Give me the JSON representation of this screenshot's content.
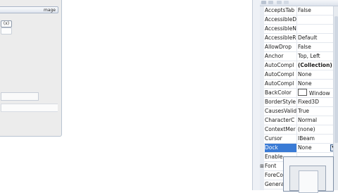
{
  "designer": {
    "caption_text": "mage",
    "tool_button_text": "(x)"
  },
  "properties": [
    {
      "name": "AcceptsTab",
      "value": "False"
    },
    {
      "name": "AccessibleD",
      "value": ""
    },
    {
      "name": "AccessibleN",
      "value": ""
    },
    {
      "name": "AccessibleR",
      "value": "Default"
    },
    {
      "name": "AllowDrop",
      "value": "False"
    },
    {
      "name": "Anchor",
      "value": "Top, Left"
    },
    {
      "name": "AutoCompl",
      "value": "(Collection)"
    },
    {
      "name": "AutoCompl",
      "value": "None"
    },
    {
      "name": "AutoCompl",
      "value": "None"
    },
    {
      "name": "BackColor",
      "value": "Window"
    },
    {
      "name": "BorderStyle",
      "value": "Fixed3D"
    },
    {
      "name": "CausesValid",
      "value": "True"
    },
    {
      "name": "CharacterC",
      "value": "Normal"
    },
    {
      "name": "ContextMer",
      "value": "(none)"
    },
    {
      "name": "Cursor",
      "value": "IBeam"
    },
    {
      "name": "Dock",
      "value": "None"
    },
    {
      "name": "Enable",
      "value": ""
    },
    {
      "name": "Font",
      "value": ""
    },
    {
      "name": "ForeCo",
      "value": ""
    },
    {
      "name": "Genera",
      "value": ""
    }
  ],
  "colors": {
    "selection": "#3a7bd5",
    "grid_background": "#ffffff",
    "panel_background": "#eef1f6"
  }
}
